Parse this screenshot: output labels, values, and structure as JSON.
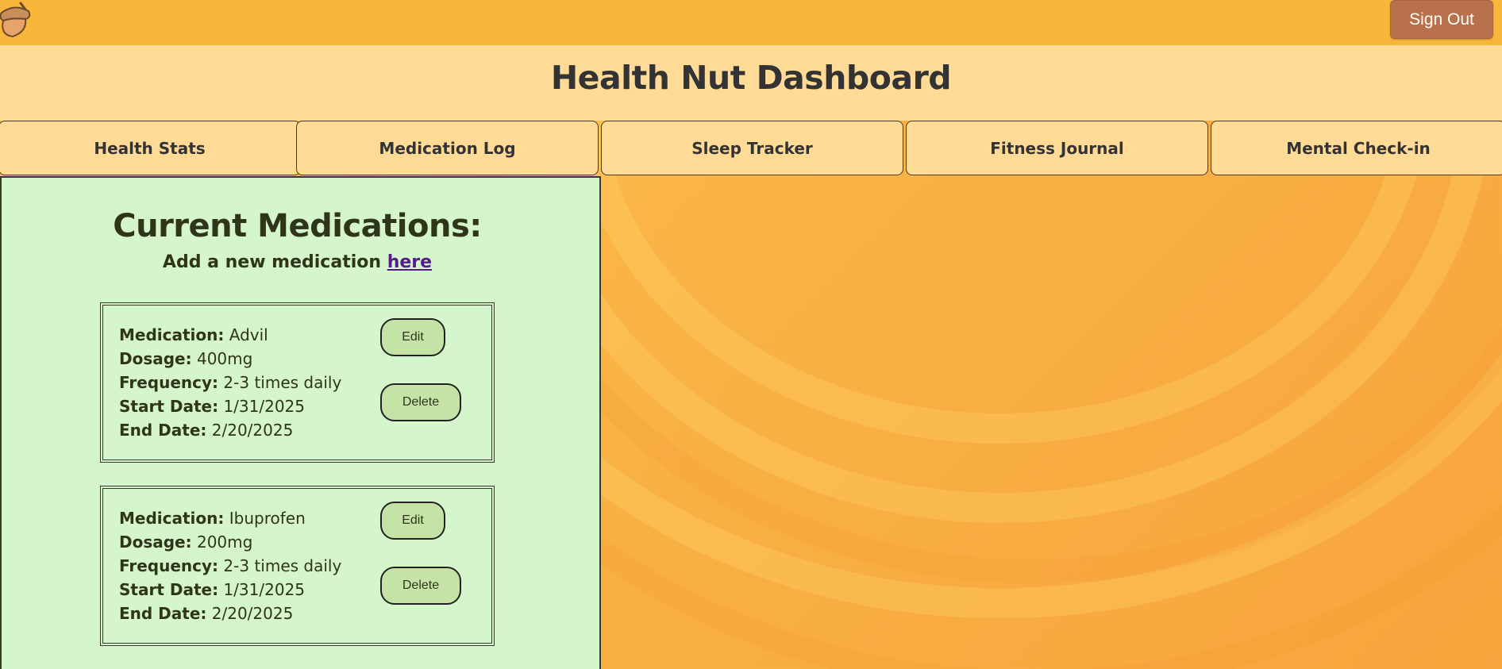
{
  "topbar": {
    "logo_icon": "acorn-icon",
    "signout_label": "Sign Out"
  },
  "header": {
    "title": "Health Nut Dashboard"
  },
  "tabs": [
    {
      "label": "Health Stats"
    },
    {
      "label": "Medication Log"
    },
    {
      "label": "Sleep Tracker"
    },
    {
      "label": "Fitness Journal"
    },
    {
      "label": "Mental Check-in"
    }
  ],
  "panel": {
    "title": "Current Medications:",
    "subtitle_prefix": "Add a new medication ",
    "subtitle_link": "here"
  },
  "field_labels": {
    "medication": "Medication:",
    "dosage": "Dosage:",
    "frequency": "Frequency:",
    "start_date": "Start Date:",
    "end_date": "End Date:"
  },
  "buttons": {
    "edit": "Edit",
    "delete": "Delete"
  },
  "medications": [
    {
      "medication": "Advil",
      "dosage": "400mg",
      "frequency": "2-3 times daily",
      "start_date": "1/31/2025",
      "end_date": "2/20/2025"
    },
    {
      "medication": "Ibuprofen",
      "dosage": "200mg",
      "frequency": "2-3 times daily",
      "start_date": "1/31/2025",
      "end_date": "2/20/2025"
    }
  ],
  "colors": {
    "topbar": "#f8b73a",
    "header": "#ffdb97",
    "panel": "#d5f5cd",
    "signout": "#b8714a",
    "button": "#c6e3a7",
    "link": "#551a8b"
  }
}
